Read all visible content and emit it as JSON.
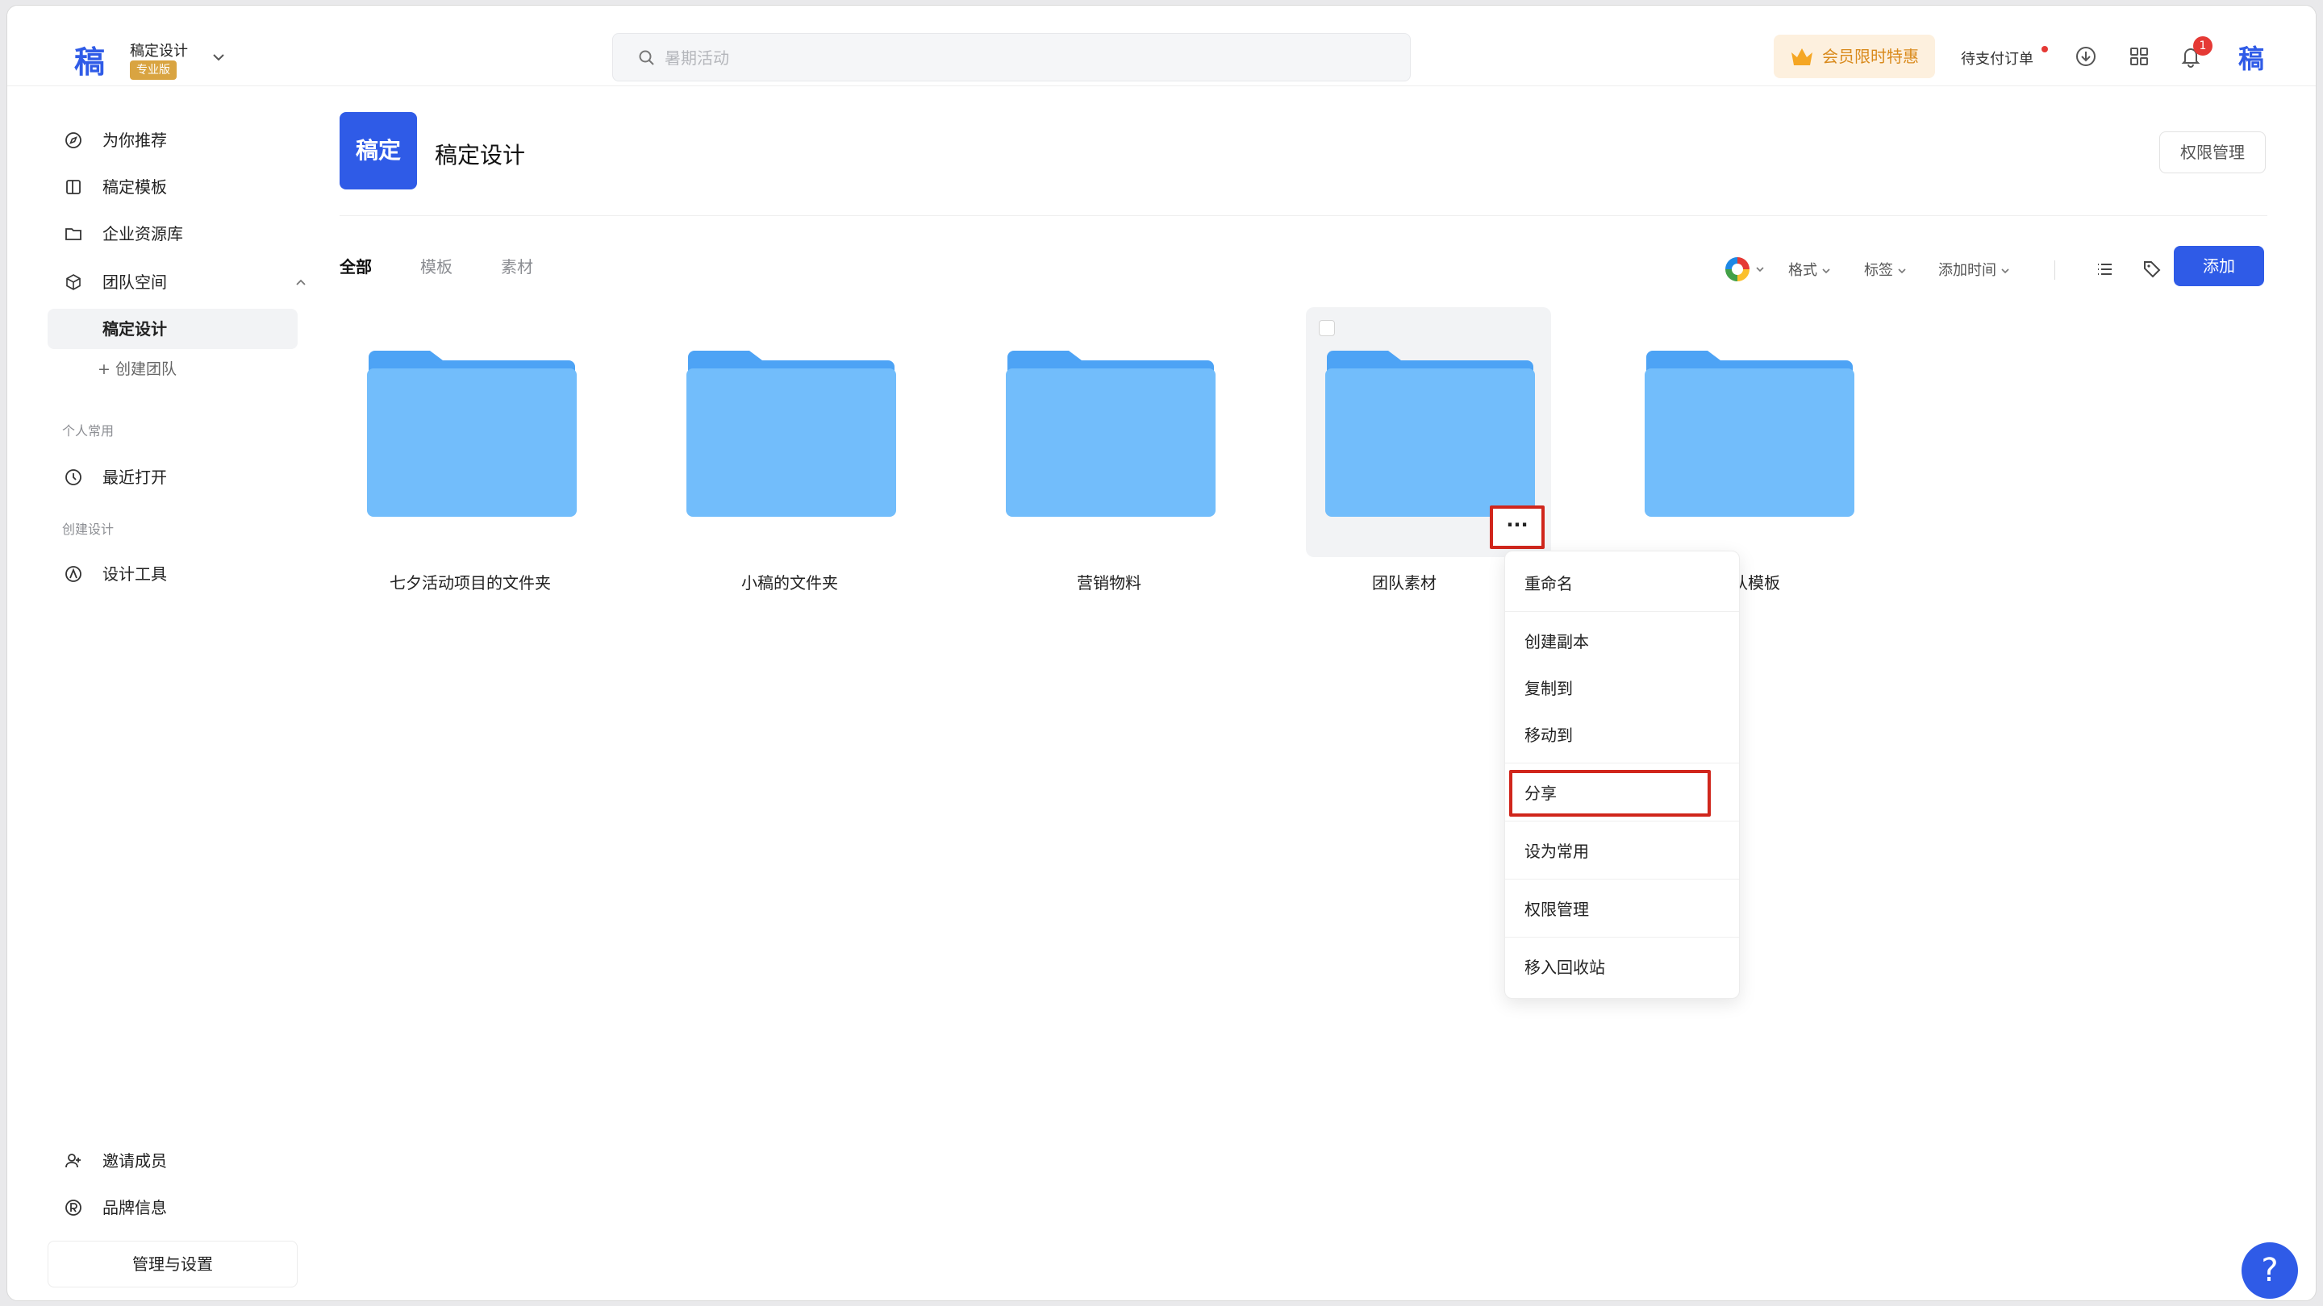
{
  "header": {
    "logo_char": "稿",
    "team_name": "稿定设计",
    "team_badge": "专业版",
    "search_placeholder": "暑期活动",
    "vip_label": "会员限时特惠",
    "orders_label": "待支付订单",
    "notification_count": "1",
    "logo_right_char": "稿"
  },
  "sidebar": {
    "items": [
      {
        "label": "为你推荐"
      },
      {
        "label": "稿定模板"
      },
      {
        "label": "企业资源库"
      },
      {
        "label": "团队空间"
      },
      {
        "label": "稿定设计"
      }
    ],
    "create_team": "+ 创建团队",
    "section_personal": "个人常用",
    "recent": "最近打开",
    "section_create": "创建设计",
    "design_tools": "设计工具",
    "invite": "邀请成员",
    "brand": "品牌信息",
    "manage": "管理与设置"
  },
  "main": {
    "space_logo": "稿定",
    "space_title": "稿定设计",
    "permission_button": "权限管理",
    "tabs": [
      {
        "label": "全部"
      },
      {
        "label": "模板"
      },
      {
        "label": "素材"
      }
    ],
    "filters": {
      "format": "格式",
      "tag": "标签",
      "added_time": "添加时间"
    },
    "add_button": "添加",
    "folders": [
      {
        "name": "七夕活动项目的文件夹"
      },
      {
        "name": "小稿的文件夹"
      },
      {
        "name": "营销物料"
      },
      {
        "name": "团队素材"
      },
      {
        "name": "团队模板"
      }
    ],
    "more_button": "···"
  },
  "context_menu": {
    "items": [
      {
        "label": "重命名"
      },
      {
        "label": "创建副本"
      },
      {
        "label": "复制到"
      },
      {
        "label": "移动到"
      },
      {
        "label": "分享"
      },
      {
        "label": "设为常用"
      },
      {
        "label": "权限管理"
      },
      {
        "label": "移入回收站"
      }
    ]
  },
  "help_label": "?",
  "colors": {
    "brand": "#2f5be7",
    "folder": "#5aaef7",
    "highlight": "#d0261c",
    "vip_text": "#d98a1c"
  }
}
